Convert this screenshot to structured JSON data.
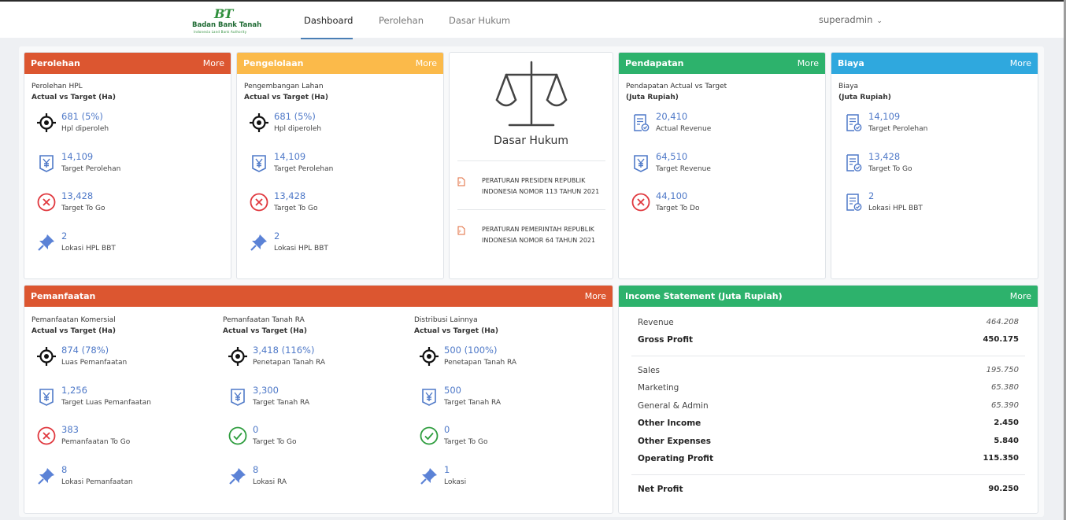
{
  "header": {
    "logo_mark": "BT",
    "logo_name": "Badan Bank Tanah",
    "logo_sub": "Indonesia Land Bank Authority",
    "tabs": [
      "Dashboard",
      "Perolehan",
      "Dasar Hukum"
    ],
    "active_tab": "Dashboard",
    "user": "superadmin"
  },
  "cards": {
    "perolehan": {
      "title": "Perolehan",
      "more": "More",
      "section_title": "Perolehan HPL",
      "section_sub": "Actual vs Target (Ha)",
      "stats": [
        {
          "value": "681 (5%)",
          "label": "Hpl diperoleh",
          "icon": "target-icon"
        },
        {
          "value": "14,109",
          "label": "Target Perolehan",
          "icon": "yen-badge-icon"
        },
        {
          "value": "13,428",
          "label": "Target To Go",
          "icon": "x-circle-icon"
        },
        {
          "value": "2",
          "label": "Lokasi HPL BBT",
          "icon": "pin-icon"
        }
      ]
    },
    "pengelolaan": {
      "title": "Pengelolaan",
      "more": "More",
      "section_title": "Pengembangan Lahan",
      "section_sub": "Actual vs Target (Ha)",
      "stats": [
        {
          "value": "681 (5%)",
          "label": "Hpl diperoleh",
          "icon": "target-icon"
        },
        {
          "value": "14,109",
          "label": "Target Perolehan",
          "icon": "yen-badge-icon"
        },
        {
          "value": "13,428",
          "label": "Target To Go",
          "icon": "x-circle-icon"
        },
        {
          "value": "2",
          "label": "Lokasi HPL BBT",
          "icon": "pin-icon"
        }
      ]
    },
    "dasar_hukum": {
      "title": "Dasar Hukum",
      "docs": [
        "PERATURAN PRESIDEN REPUBLIK INDONESIA NOMOR 113 TAHUN 2021",
        "PERATURAN PEMERINTAH REPUBLIK INDONESIA NOMOR 64 TAHUN 2021"
      ]
    },
    "pendapatan": {
      "title": "Pendapatan",
      "more": "More",
      "section_title": "Pendapatan Actual vs Target",
      "section_sub": "(Juta Rupiah)",
      "stats": [
        {
          "value": "20,410",
          "label": "Actual Revenue",
          "icon": "document-check-icon"
        },
        {
          "value": "64,510",
          "label": "Target Revenue",
          "icon": "yen-badge-icon"
        },
        {
          "value": "44,100",
          "label": "Target To Do",
          "icon": "x-circle-icon"
        }
      ]
    },
    "biaya": {
      "title": "Biaya",
      "more": "More",
      "section_title": "Biaya",
      "section_sub": "(Juta Rupiah)",
      "stats": [
        {
          "value": "14,109",
          "label": "Target Perolehan",
          "icon": "document-check-icon"
        },
        {
          "value": "13,428",
          "label": "Target To Go",
          "icon": "document-check-icon"
        },
        {
          "value": "2",
          "label": "Lokasi HPL BBT",
          "icon": "document-check-icon"
        }
      ]
    },
    "pemanfaatan": {
      "title": "Pemanfaatan",
      "more": "More",
      "columns": [
        {
          "section_title": "Pemanfaatan Komersial",
          "section_sub": "Actual vs Target (Ha)",
          "stats": [
            {
              "value": "874 (78%)",
              "label": "Luas Pemanfaatan",
              "icon": "target-icon"
            },
            {
              "value": "1,256",
              "label": "Target Luas Pemanfaatan",
              "icon": "yen-badge-icon"
            },
            {
              "value": "383",
              "label": "Pemanfaatan To Go",
              "icon": "x-circle-icon"
            },
            {
              "value": "8",
              "label": "Lokasi Pemanfaatan",
              "icon": "pin-icon"
            }
          ]
        },
        {
          "section_title": "Pemanfaatan Tanah RA",
          "section_sub": "Actual vs Target (Ha)",
          "stats": [
            {
              "value": "3,418 (116%)",
              "label": "Penetapan Tanah RA",
              "icon": "target-icon"
            },
            {
              "value": "3,300",
              "label": "Target Tanah RA",
              "icon": "yen-badge-icon"
            },
            {
              "value": "0",
              "label": "Target To Go",
              "icon": "check-circle-icon"
            },
            {
              "value": "8",
              "label": "Lokasi RA",
              "icon": "pin-icon"
            }
          ]
        },
        {
          "section_title": "Distribusi Lainnya",
          "section_sub": "Actual vs Target (Ha)",
          "stats": [
            {
              "value": "500 (100%)",
              "label": "Penetapan Tanah RA",
              "icon": "target-icon"
            },
            {
              "value": "500",
              "label": "Target Tanah RA",
              "icon": "yen-badge-icon"
            },
            {
              "value": "0",
              "label": "Target To Go",
              "icon": "check-circle-icon"
            },
            {
              "value": "1",
              "label": "Lokasi",
              "icon": "pin-icon"
            }
          ]
        }
      ]
    },
    "income": {
      "title": "Income Statement (Juta Rupiah)",
      "more": "More",
      "rows": [
        {
          "label": "Revenue",
          "value": "464.208",
          "bold": false
        },
        {
          "label": "Gross Profit",
          "value": "450.175",
          "bold": true
        },
        {
          "label": "Sales",
          "value": "195.750",
          "bold": false
        },
        {
          "label": "Marketing",
          "value": "65.380",
          "bold": false
        },
        {
          "label": "General & Admin",
          "value": "65.390",
          "bold": false
        },
        {
          "label": "Other Income",
          "value": "2.450",
          "bold": true
        },
        {
          "label": "Other Expenses",
          "value": "5.840",
          "bold": true
        },
        {
          "label": "Operating Profit",
          "value": "115.350",
          "bold": true
        },
        {
          "label": "Net Profit",
          "value": "90.250",
          "bold": true
        }
      ]
    }
  },
  "colors": {
    "orange": "#dc5630",
    "yellow": "#fbba4a",
    "green": "#2db26c",
    "blue": "#2fa8de",
    "value_blue": "#4f79c8",
    "red": "#e0383e",
    "check_green": "#2e9d3e",
    "pin_blue": "#5b82d6"
  }
}
